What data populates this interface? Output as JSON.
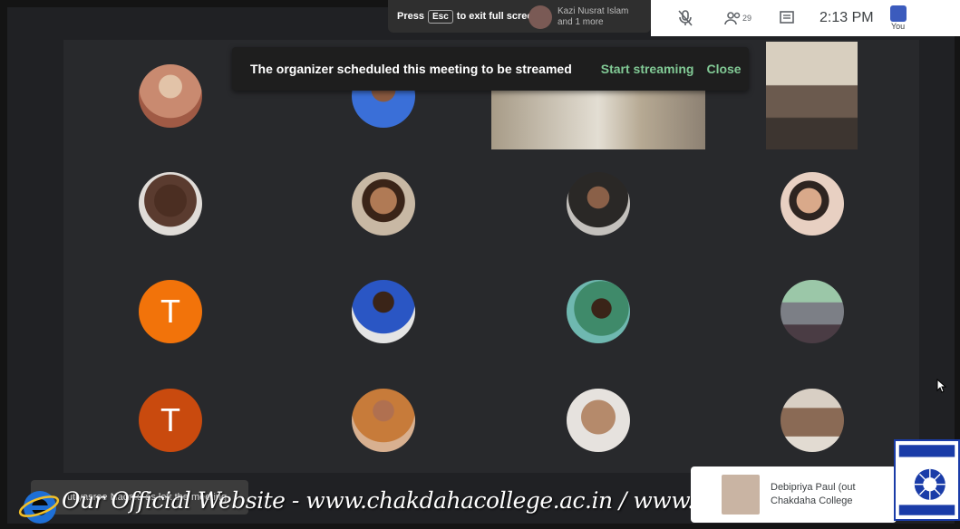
{
  "top": {
    "esc_press": "Press",
    "esc_key": "Esc",
    "esc_suffix": "to exit full screen",
    "presenter_name": "Kazi Nusrat Islam",
    "presenter_more": "and 1 more"
  },
  "controls": {
    "mic_icon": "mic-off-icon",
    "people_icon": "people-icon",
    "people_count": "29",
    "chat_icon": "chat-icon",
    "clock": "2:13 PM",
    "you_label": "You"
  },
  "banner": {
    "message": "The organizer scheduled this meeting to be streamed",
    "start_label": "Start streaming",
    "close_label": "Close"
  },
  "tiles": [
    {
      "type": "photo",
      "color": "#c98a70"
    },
    {
      "type": "photo",
      "color": "#3a6fd8"
    },
    {
      "type": "video",
      "color": "#b6a993"
    },
    {
      "type": "video",
      "color": "#6b5a4e"
    },
    {
      "type": "photo",
      "color": "#5a3b2f"
    },
    {
      "type": "photo",
      "color": "#b07a55"
    },
    {
      "type": "photo",
      "color": "#3d3a36"
    },
    {
      "type": "photo",
      "color": "#e8d0c2"
    },
    {
      "type": "letter",
      "letter": "T",
      "color": "#f2730a"
    },
    {
      "type": "photo",
      "color": "#2a56c4"
    },
    {
      "type": "photo",
      "color": "#3f8a6a"
    },
    {
      "type": "photo",
      "color": "#7c7f86"
    },
    {
      "type": "letter",
      "letter": "T",
      "color": "#c94a0e"
    },
    {
      "type": "photo",
      "color": "#c77b3a"
    },
    {
      "type": "photo",
      "color": "#b58a6b"
    },
    {
      "type": "photo",
      "color": "#d8cfc4"
    }
  ],
  "bottom": {
    "left_notice": "utiyasree Naomu as left the meeting",
    "watermark": "Our Official  Website - www.chakdahacollege.ac.in / www.chakdahacollege.org",
    "join_name": "Debipriya Paul (out",
    "join_sub": "Chakdaha College"
  },
  "colors": {
    "accent_green": "#81c995",
    "meet_bg": "#202124"
  }
}
